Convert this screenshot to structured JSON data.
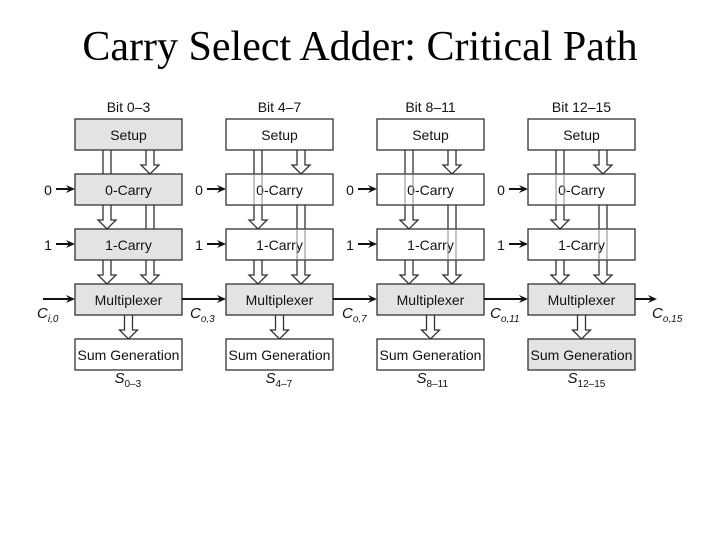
{
  "title": "Carry Select Adder: Critical Path",
  "colors": {
    "highlight": "#e3e3e3",
    "normal": "#ffffff",
    "stroke": "#333333"
  },
  "columns": [
    {
      "header": "Bit 0–3",
      "blocks": [
        {
          "label": "Setup",
          "critical": true
        },
        {
          "label": "0-Carry",
          "critical": true
        },
        {
          "label": "1-Carry",
          "critical": true
        },
        {
          "label": "Multiplexer",
          "critical": true
        },
        {
          "label": "Sum Generation",
          "critical": false
        }
      ],
      "inputs": {
        "zero": "0",
        "one": "1"
      },
      "sum": {
        "base": "S",
        "sub": "0–3"
      }
    },
    {
      "header": "Bit 4–7",
      "blocks": [
        {
          "label": "Setup",
          "critical": false
        },
        {
          "label": "0-Carry",
          "critical": false
        },
        {
          "label": "1-Carry",
          "critical": false
        },
        {
          "label": "Multiplexer",
          "critical": true
        },
        {
          "label": "Sum Generation",
          "critical": false
        }
      ],
      "inputs": {
        "zero": "0",
        "one": "1"
      },
      "sum": {
        "base": "S",
        "sub": "4–7"
      }
    },
    {
      "header": "Bit 8–11",
      "blocks": [
        {
          "label": "Setup",
          "critical": false
        },
        {
          "label": "0-Carry",
          "critical": false
        },
        {
          "label": "1-Carry",
          "critical": false
        },
        {
          "label": "Multiplexer",
          "critical": true
        },
        {
          "label": "Sum Generation",
          "critical": false
        }
      ],
      "inputs": {
        "zero": "0",
        "one": "1"
      },
      "sum": {
        "base": "S",
        "sub": "8–11"
      }
    },
    {
      "header": "Bit 12–15",
      "blocks": [
        {
          "label": "Setup",
          "critical": false
        },
        {
          "label": "0-Carry",
          "critical": false
        },
        {
          "label": "1-Carry",
          "critical": false
        },
        {
          "label": "Multiplexer",
          "critical": true
        },
        {
          "label": "Sum Generation",
          "critical": true
        }
      ],
      "inputs": {
        "zero": "0",
        "one": "1"
      },
      "sum": {
        "base": "S",
        "sub": "12–15"
      }
    }
  ],
  "carries": [
    {
      "base": "C",
      "sub": "i,0"
    },
    {
      "base": "C",
      "sub": "o,3"
    },
    {
      "base": "C",
      "sub": "o,7"
    },
    {
      "base": "C",
      "sub": "o,11"
    },
    {
      "base": "C",
      "sub": "o,15"
    }
  ]
}
